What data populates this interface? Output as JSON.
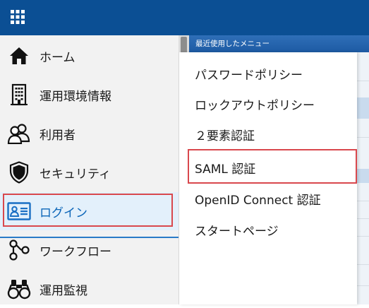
{
  "sidebar": {
    "items": [
      {
        "label": "ホーム",
        "icon": "home-icon"
      },
      {
        "label": "運用環境情報",
        "icon": "building-icon"
      },
      {
        "label": "利用者",
        "icon": "users-icon"
      },
      {
        "label": "セキュリティ",
        "icon": "shield-icon"
      },
      {
        "label": "ログイン",
        "icon": "id-card-icon",
        "active": true
      },
      {
        "label": "ワークフロー",
        "icon": "workflow-icon"
      },
      {
        "label": "運用監視",
        "icon": "binoculars-icon"
      }
    ]
  },
  "submenu": {
    "header": "最近使用したメニュー",
    "items": [
      "パスワードポリシー",
      "ロックアウトポリシー",
      "２要素認証",
      "SAML 認証",
      "OpenID Connect 認証",
      "スタートページ"
    ]
  },
  "colors": {
    "topbar": "#0b4f94",
    "active_text": "#0b65b8",
    "highlight_border": "#d9484d"
  }
}
